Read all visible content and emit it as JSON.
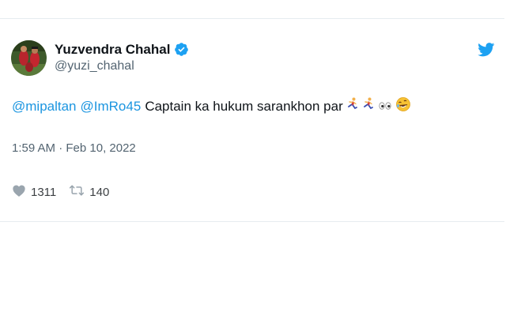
{
  "tweet": {
    "author": {
      "display_name": "Yuzvendra Chahal",
      "handle": "@yuzi_chahal",
      "verified": true
    },
    "text": {
      "mention_1": "@mipaltan",
      "mention_2": "@ImRo45",
      "body": "Captain ka hukum sarankhon par",
      "emojis": [
        "running-person-icon",
        "running-person-icon",
        "eyes-icon",
        "rolling-laughing-face-icon"
      ]
    },
    "timestamp": "1:59 AM · Feb 10, 2022",
    "stats": {
      "likes": "1311",
      "retweets": "140"
    }
  },
  "colors": {
    "mention": "#1b95e0",
    "secondary_text": "#536471",
    "verified_badge": "#1da1f2",
    "twitter_logo": "#1da1f2",
    "border": "#e6ecf0"
  }
}
